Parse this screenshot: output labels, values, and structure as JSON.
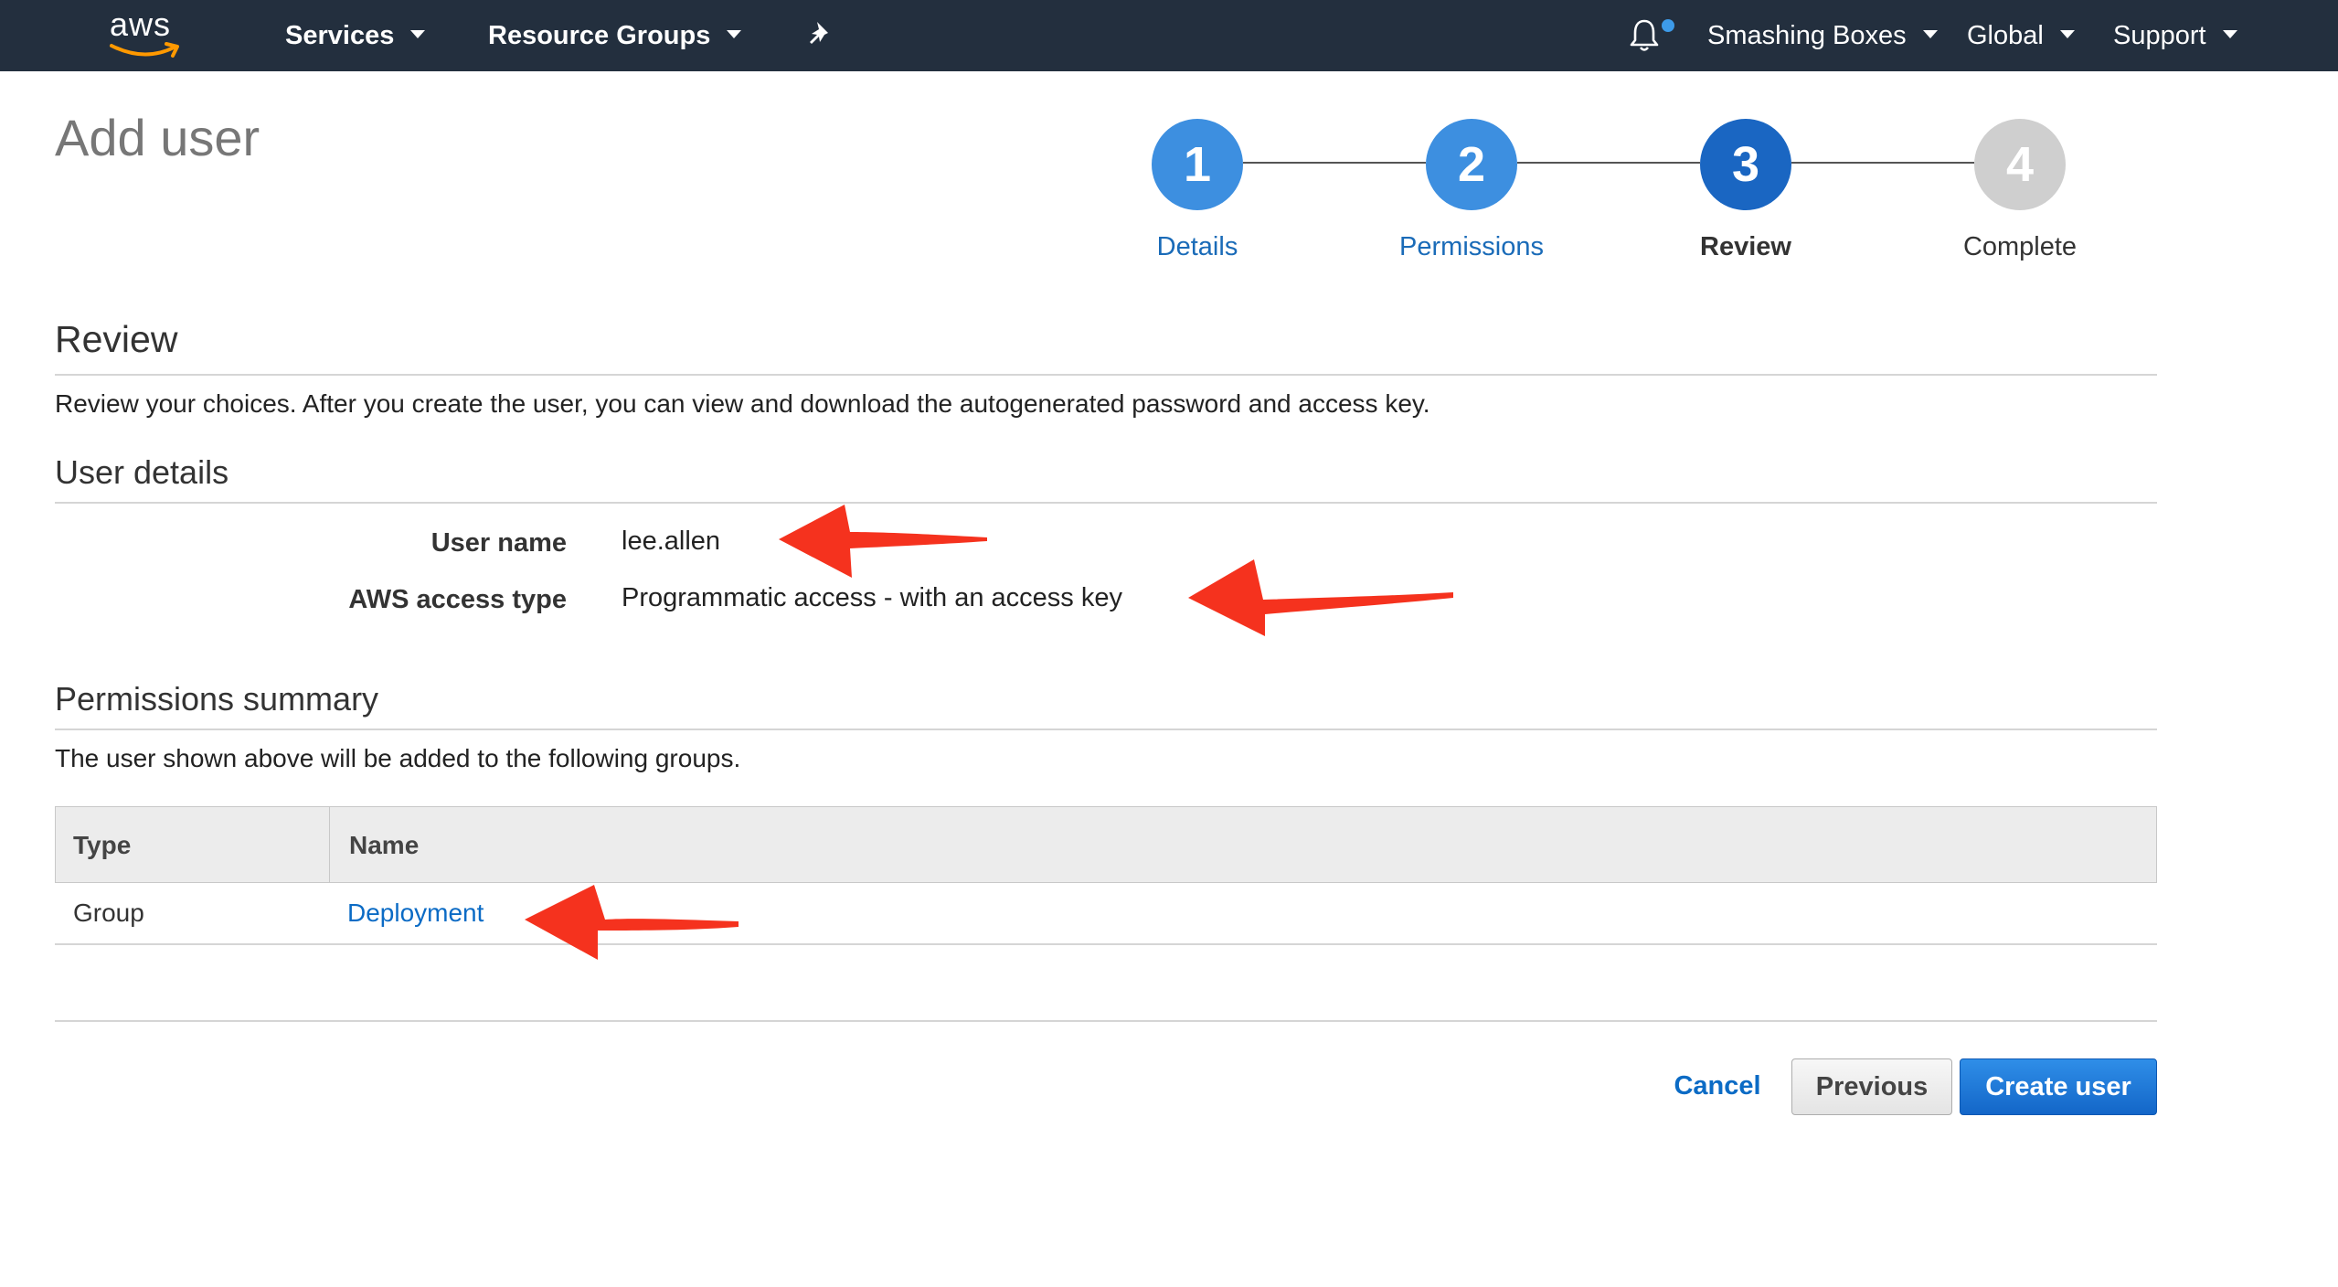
{
  "nav": {
    "logo_text": "aws",
    "services": "Services",
    "resource_groups": "Resource Groups",
    "account": "Smashing Boxes",
    "region": "Global",
    "support": "Support",
    "notification_dot_color": "#3d9be9",
    "icons": [
      "pin-icon",
      "bell-icon"
    ]
  },
  "page": {
    "title": "Add user"
  },
  "wizard": {
    "steps": [
      {
        "number": "1",
        "label": "Details",
        "state": "completed",
        "color": "#3d8fe0",
        "label_color": "#1a6bb8"
      },
      {
        "number": "2",
        "label": "Permissions",
        "state": "completed",
        "color": "#3d8fe0",
        "label_color": "#1a6bb8"
      },
      {
        "number": "3",
        "label": "Review",
        "state": "current",
        "color": "#1a66c2",
        "label_color": "#333333"
      },
      {
        "number": "4",
        "label": "Complete",
        "state": "upcoming",
        "color": "#cfcfcf",
        "label_color": "#333333"
      }
    ]
  },
  "review": {
    "heading": "Review",
    "description": "Review your choices. After you create the user, you can view and download the autogenerated password and access key."
  },
  "user_details": {
    "heading": "User details",
    "username_label": "User name",
    "username_value": "lee.allen",
    "access_type_label": "AWS access type",
    "access_type_value": "Programmatic access - with an access key"
  },
  "permissions": {
    "heading": "Permissions summary",
    "description": "The user shown above will be added to the following groups.",
    "columns": [
      "Type",
      "Name"
    ],
    "rows": [
      {
        "type": "Group",
        "name": "Deployment"
      }
    ]
  },
  "actions": {
    "cancel": "Cancel",
    "previous": "Previous",
    "create": "Create user"
  },
  "annotations": {
    "arrow_color": "#f5321e"
  }
}
